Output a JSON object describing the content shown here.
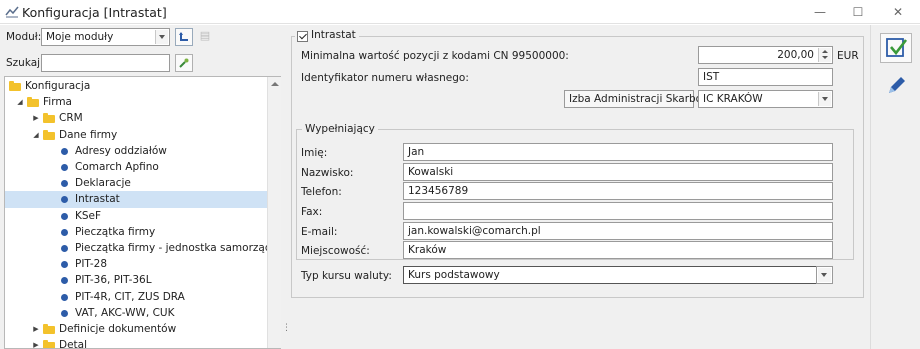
{
  "window": {
    "title": "Konfiguracja [Intrastat]",
    "minimize": "—",
    "maximize": "☐",
    "close": "✕"
  },
  "left": {
    "module_label": "Moduł:",
    "module_value": "Moje moduły",
    "search_label": "Szukaj:",
    "search_value": "",
    "tree": [
      {
        "label": "Konfiguracja",
        "kind": "folder",
        "level": 0,
        "expander": ""
      },
      {
        "label": "Firma",
        "kind": "folder",
        "level": 1,
        "expander": "◢"
      },
      {
        "label": "CRM",
        "kind": "folder",
        "level": 2,
        "expander": "▶"
      },
      {
        "label": "Dane firmy",
        "kind": "folder",
        "level": 2,
        "expander": "◢"
      },
      {
        "label": "Adresy oddziałów",
        "kind": "leaf",
        "level": 3,
        "expander": ""
      },
      {
        "label": "Comarch Apfino",
        "kind": "leaf",
        "level": 3,
        "expander": ""
      },
      {
        "label": "Deklaracje",
        "kind": "leaf",
        "level": 3,
        "expander": ""
      },
      {
        "label": "Intrastat",
        "kind": "leaf",
        "level": 3,
        "expander": "",
        "selected": true
      },
      {
        "label": "KSeF",
        "kind": "leaf",
        "level": 3,
        "expander": ""
      },
      {
        "label": "Pieczątka firmy",
        "kind": "leaf",
        "level": 3,
        "expander": ""
      },
      {
        "label": "Pieczątka firmy - jednostka samorządowa",
        "kind": "leaf",
        "level": 3,
        "expander": ""
      },
      {
        "label": "PIT-28",
        "kind": "leaf",
        "level": 3,
        "expander": ""
      },
      {
        "label": "PIT-36, PIT-36L",
        "kind": "leaf",
        "level": 3,
        "expander": ""
      },
      {
        "label": "PIT-4R, CIT, ZUS DRA",
        "kind": "leaf",
        "level": 3,
        "expander": ""
      },
      {
        "label": "VAT, AKC-WW, CUK",
        "kind": "leaf",
        "level": 3,
        "expander": ""
      },
      {
        "label": "Definicje dokumentów",
        "kind": "folder",
        "level": 2,
        "expander": "▶"
      },
      {
        "label": "Detal",
        "kind": "folder",
        "level": 2,
        "expander": "▶"
      }
    ]
  },
  "form": {
    "intrastat_label": "Intrastat",
    "intrastat_checked": true,
    "min_value_label": "Minimalna wartość pozycji z kodami CN 99500000:",
    "min_value": "200,00",
    "currency": "EUR",
    "id_label": "Identyfikator numeru własnego:",
    "id_value": "IST",
    "izba_label": "Izba Administracji Skarbowej:",
    "izba_value": "IC KRAKÓW",
    "filler_legend": "Wypełniający",
    "first_name_label": "Imię:",
    "first_name": "Jan",
    "last_name_label": "Nazwisko:",
    "last_name": "Kowalski",
    "phone_label": "Telefon:",
    "phone": "123456789",
    "fax_label": "Fax:",
    "fax": "",
    "email_label": "E-mail:",
    "email": "jan.kowalski@comarch.pl",
    "city_label": "Miejscowość:",
    "city": "Kraków",
    "rate_label": "Typ kursu waluty:",
    "rate_value": "Kurs podstawowy"
  },
  "colors": {
    "accent": "#2d5ca8",
    "folder": "#f3c22c",
    "selection": "#cfe2f5"
  }
}
